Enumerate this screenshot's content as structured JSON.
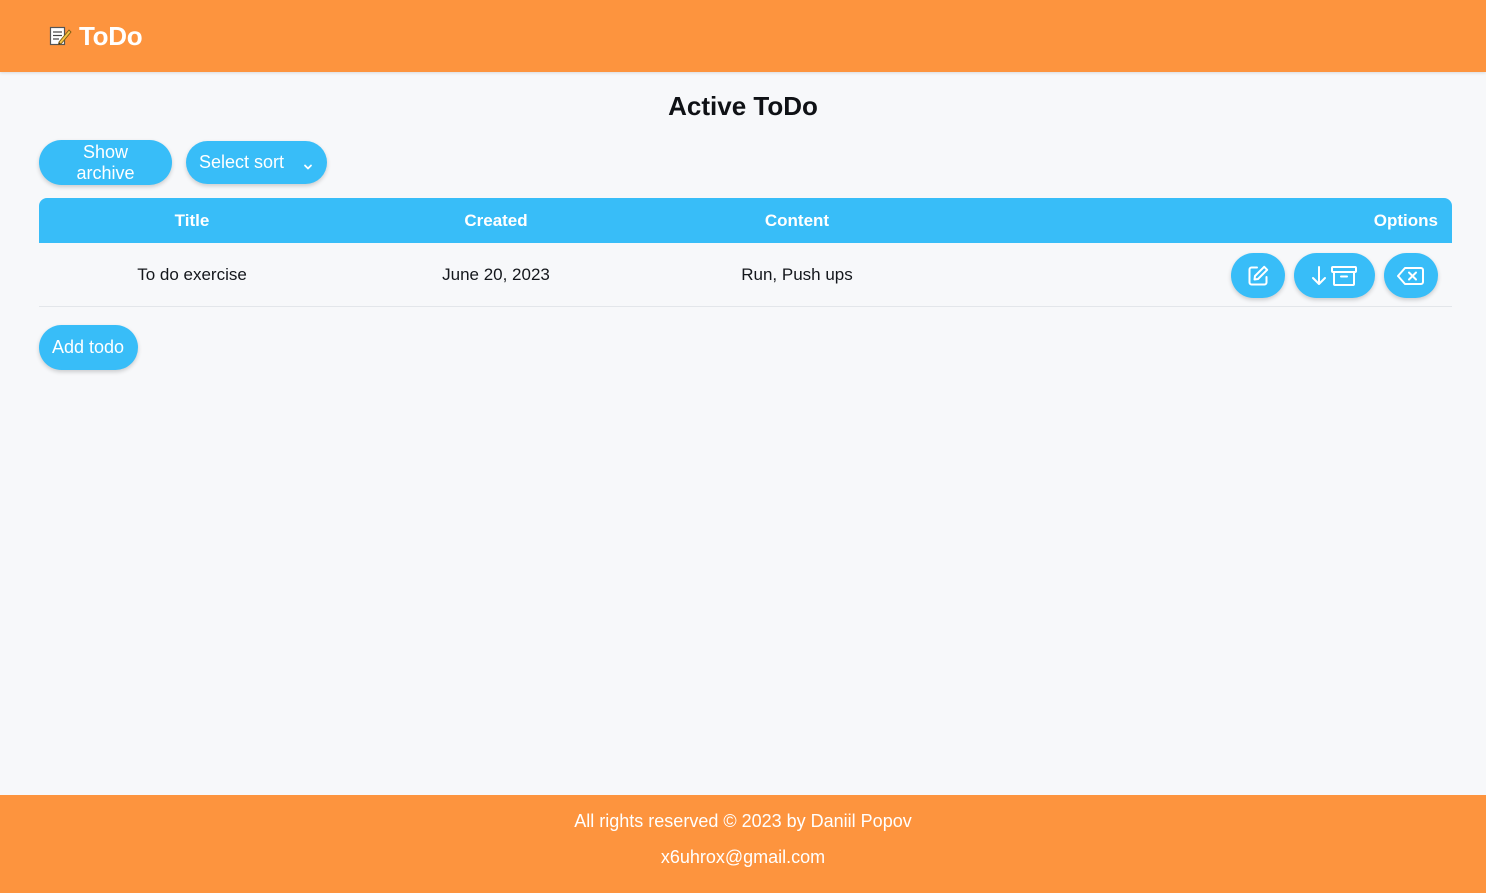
{
  "header": {
    "brand_icon": "memo-icon",
    "brand": "ToDo",
    "color": "#fd943e"
  },
  "main": {
    "title": "Active ToDo",
    "show_archive_label": "Show archive",
    "sort": {
      "selected": "Select sort",
      "icon": "chevron-down-icon"
    },
    "add_label": "Add todo",
    "accent": "#38bdf8"
  },
  "table": {
    "columns": [
      "Title",
      "Created",
      "Content",
      "Options"
    ],
    "rows": [
      {
        "title": "To do exercise",
        "created": "June 20, 2023",
        "content": "Run, Push ups",
        "options": [
          "edit-icon",
          "archive-icon",
          "delete-icon"
        ]
      }
    ]
  },
  "footer": {
    "copyright": "All rights reserved © 2023 by Daniil Popov",
    "email": "x6uhrox@gmail.com"
  }
}
